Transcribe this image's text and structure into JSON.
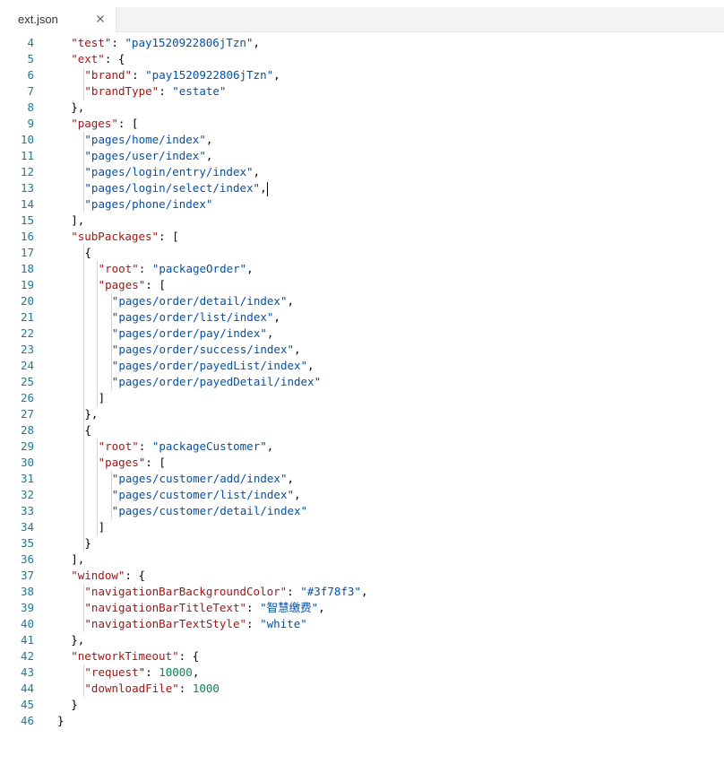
{
  "tab": {
    "filename": "ext.json"
  },
  "lines": [
    {
      "n": "4",
      "indent": 1,
      "parts": [
        [
          "k",
          "\"test\""
        ],
        [
          "p",
          ": "
        ],
        [
          "s",
          "\"pay1520922806jTzn\""
        ],
        [
          "p",
          ","
        ]
      ]
    },
    {
      "n": "5",
      "indent": 1,
      "parts": [
        [
          "k",
          "\"ext\""
        ],
        [
          "p",
          ": {"
        ]
      ]
    },
    {
      "n": "6",
      "indent": 2,
      "parts": [
        [
          "k",
          "\"brand\""
        ],
        [
          "p",
          ": "
        ],
        [
          "s",
          "\"pay1520922806jTzn\""
        ],
        [
          "p",
          ","
        ]
      ]
    },
    {
      "n": "7",
      "indent": 2,
      "parts": [
        [
          "k",
          "\"brandType\""
        ],
        [
          "p",
          ": "
        ],
        [
          "s",
          "\"estate\""
        ]
      ]
    },
    {
      "n": "8",
      "indent": 1,
      "parts": [
        [
          "p",
          "},"
        ]
      ]
    },
    {
      "n": "9",
      "indent": 1,
      "parts": [
        [
          "k",
          "\"pages\""
        ],
        [
          "p",
          ": ["
        ]
      ]
    },
    {
      "n": "10",
      "indent": 2,
      "parts": [
        [
          "s",
          "\"pages/home/index\""
        ],
        [
          "p",
          ","
        ]
      ]
    },
    {
      "n": "11",
      "indent": 2,
      "parts": [
        [
          "s",
          "\"pages/user/index\""
        ],
        [
          "p",
          ","
        ]
      ]
    },
    {
      "n": "12",
      "indent": 2,
      "parts": [
        [
          "s",
          "\"pages/login/entry/index\""
        ],
        [
          "p",
          ","
        ]
      ]
    },
    {
      "n": "13",
      "indent": 2,
      "parts": [
        [
          "s",
          "\"pages/login/select/index\""
        ],
        [
          "p",
          ","
        ]
      ],
      "cursor": true
    },
    {
      "n": "14",
      "indent": 2,
      "parts": [
        [
          "s",
          "\"pages/phone/index\""
        ]
      ]
    },
    {
      "n": "15",
      "indent": 1,
      "parts": [
        [
          "p",
          "],"
        ]
      ]
    },
    {
      "n": "16",
      "indent": 1,
      "parts": [
        [
          "k",
          "\"subPackages\""
        ],
        [
          "p",
          ": ["
        ]
      ]
    },
    {
      "n": "17",
      "indent": 2,
      "parts": [
        [
          "p",
          "{"
        ]
      ]
    },
    {
      "n": "18",
      "indent": 3,
      "parts": [
        [
          "k",
          "\"root\""
        ],
        [
          "p",
          ": "
        ],
        [
          "s",
          "\"packageOrder\""
        ],
        [
          "p",
          ","
        ]
      ]
    },
    {
      "n": "19",
      "indent": 3,
      "parts": [
        [
          "k",
          "\"pages\""
        ],
        [
          "p",
          ": ["
        ]
      ]
    },
    {
      "n": "20",
      "indent": 4,
      "parts": [
        [
          "s",
          "\"pages/order/detail/index\""
        ],
        [
          "p",
          ","
        ]
      ]
    },
    {
      "n": "21",
      "indent": 4,
      "parts": [
        [
          "s",
          "\"pages/order/list/index\""
        ],
        [
          "p",
          ","
        ]
      ]
    },
    {
      "n": "22",
      "indent": 4,
      "parts": [
        [
          "s",
          "\"pages/order/pay/index\""
        ],
        [
          "p",
          ","
        ]
      ]
    },
    {
      "n": "23",
      "indent": 4,
      "parts": [
        [
          "s",
          "\"pages/order/success/index\""
        ],
        [
          "p",
          ","
        ]
      ]
    },
    {
      "n": "24",
      "indent": 4,
      "parts": [
        [
          "s",
          "\"pages/order/payedList/index\""
        ],
        [
          "p",
          ","
        ]
      ]
    },
    {
      "n": "25",
      "indent": 4,
      "parts": [
        [
          "s",
          "\"pages/order/payedDetail/index\""
        ]
      ]
    },
    {
      "n": "26",
      "indent": 3,
      "parts": [
        [
          "p",
          "]"
        ]
      ]
    },
    {
      "n": "27",
      "indent": 2,
      "parts": [
        [
          "p",
          "},"
        ]
      ]
    },
    {
      "n": "28",
      "indent": 2,
      "parts": [
        [
          "p",
          "{"
        ]
      ]
    },
    {
      "n": "29",
      "indent": 3,
      "parts": [
        [
          "k",
          "\"root\""
        ],
        [
          "p",
          ": "
        ],
        [
          "s",
          "\"packageCustomer\""
        ],
        [
          "p",
          ","
        ]
      ]
    },
    {
      "n": "30",
      "indent": 3,
      "parts": [
        [
          "k",
          "\"pages\""
        ],
        [
          "p",
          ": ["
        ]
      ]
    },
    {
      "n": "31",
      "indent": 4,
      "parts": [
        [
          "s",
          "\"pages/customer/add/index\""
        ],
        [
          "p",
          ","
        ]
      ]
    },
    {
      "n": "32",
      "indent": 4,
      "parts": [
        [
          "s",
          "\"pages/customer/list/index\""
        ],
        [
          "p",
          ","
        ]
      ]
    },
    {
      "n": "33",
      "indent": 4,
      "parts": [
        [
          "s",
          "\"pages/customer/detail/index\""
        ]
      ]
    },
    {
      "n": "34",
      "indent": 3,
      "parts": [
        [
          "p",
          "]"
        ]
      ]
    },
    {
      "n": "35",
      "indent": 2,
      "parts": [
        [
          "p",
          "}"
        ]
      ]
    },
    {
      "n": "36",
      "indent": 1,
      "parts": [
        [
          "p",
          "],"
        ]
      ]
    },
    {
      "n": "37",
      "indent": 1,
      "parts": [
        [
          "k",
          "\"window\""
        ],
        [
          "p",
          ": {"
        ]
      ]
    },
    {
      "n": "38",
      "indent": 2,
      "parts": [
        [
          "k",
          "\"navigationBarBackgroundColor\""
        ],
        [
          "p",
          ": "
        ],
        [
          "s",
          "\"#3f78f3\""
        ],
        [
          "p",
          ","
        ]
      ]
    },
    {
      "n": "39",
      "indent": 2,
      "parts": [
        [
          "k",
          "\"navigationBarTitleText\""
        ],
        [
          "p",
          ": "
        ],
        [
          "s",
          "\"智慧缴费\""
        ],
        [
          "p",
          ","
        ]
      ]
    },
    {
      "n": "40",
      "indent": 2,
      "parts": [
        [
          "k",
          "\"navigationBarTextStyle\""
        ],
        [
          "p",
          ": "
        ],
        [
          "s",
          "\"white\""
        ]
      ]
    },
    {
      "n": "41",
      "indent": 1,
      "parts": [
        [
          "p",
          "},"
        ]
      ]
    },
    {
      "n": "42",
      "indent": 1,
      "parts": [
        [
          "k",
          "\"networkTimeout\""
        ],
        [
          "p",
          ": {"
        ]
      ]
    },
    {
      "n": "43",
      "indent": 2,
      "parts": [
        [
          "k",
          "\"request\""
        ],
        [
          "p",
          ": "
        ],
        [
          "n",
          "10000"
        ],
        [
          "p",
          ","
        ]
      ]
    },
    {
      "n": "44",
      "indent": 2,
      "parts": [
        [
          "k",
          "\"downloadFile\""
        ],
        [
          "p",
          ": "
        ],
        [
          "n",
          "1000"
        ]
      ]
    },
    {
      "n": "45",
      "indent": 1,
      "parts": [
        [
          "p",
          "}"
        ]
      ]
    },
    {
      "n": "46",
      "indent": 0,
      "parts": [
        [
          "p",
          "}"
        ]
      ]
    }
  ],
  "colors": {
    "key": "#a31515",
    "string": "#0451a5",
    "number": "#098658",
    "line_number": "#237893",
    "guide": "#d3d3d3"
  }
}
